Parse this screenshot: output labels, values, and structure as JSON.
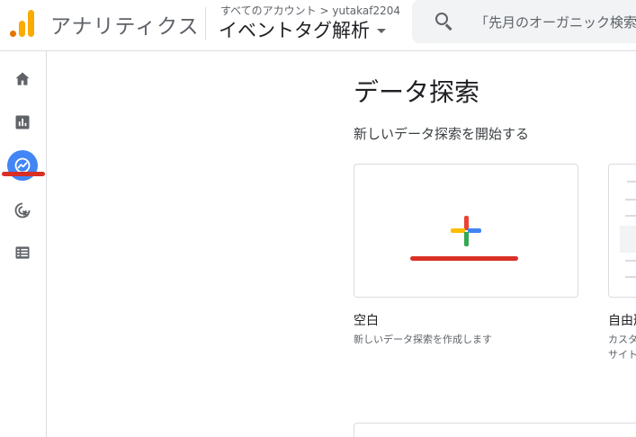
{
  "header": {
    "app_name": "アナリティクス",
    "breadcrumb": "すべてのアカウント > yutakaf2204",
    "property_name": "イベントタグ解析",
    "search_placeholder": "「先月のオーガニック検索"
  },
  "sidebar": {
    "items": [
      {
        "name": "home",
        "icon": "home-icon"
      },
      {
        "name": "reports",
        "icon": "bar-chart-icon"
      },
      {
        "name": "explore",
        "icon": "explore-icon",
        "active": true
      },
      {
        "name": "advertising",
        "icon": "target-cursor-icon"
      },
      {
        "name": "configure",
        "icon": "list-icon"
      }
    ]
  },
  "main": {
    "title": "データ探索",
    "section_title": "新しいデータ探索を開始する",
    "cards": [
      {
        "label": "空白",
        "description": "新しいデータ探索を作成します"
      },
      {
        "label": "自由形",
        "description": "カスタ",
        "description2": "サイト"
      }
    ]
  },
  "colors": {
    "accent_blue": "#4285f4",
    "annotation_red": "#d93025",
    "logo_orange": "#f9ab00"
  }
}
